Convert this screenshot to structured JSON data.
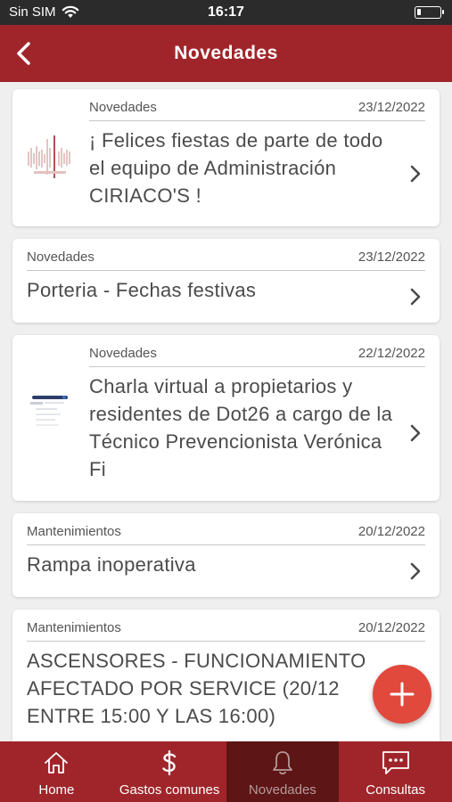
{
  "status_bar": {
    "carrier": "Sin SIM",
    "time": "16:17"
  },
  "header": {
    "title": "Novedades"
  },
  "items": [
    {
      "category": "Novedades",
      "date": "23/12/2022",
      "title": "¡ Felices fiestas de parte de todo el equipo de Administración CIRIACO'S !"
    },
    {
      "category": "Novedades",
      "date": "23/12/2022",
      "title": "Porteria - Fechas festivas"
    },
    {
      "category": "Novedades",
      "date": "22/12/2022",
      "title": "Charla virtual a propietarios y residentes de Dot26 a cargo de la Técnico Prevencionista Verónica Fi"
    },
    {
      "category": "Mantenimientos",
      "date": "20/12/2022",
      "title": "Rampa inoperativa"
    },
    {
      "category": "Mantenimientos",
      "date": "20/12/2022",
      "title": "ASCENSORES - FUNCIONAMIENTO AFECTADO POR SERVICE (20/12 ENTRE 15:00 Y LAS 16:00)"
    }
  ],
  "nav": [
    {
      "label": "Home",
      "icon": "home-icon"
    },
    {
      "label": "Gastos comunes",
      "icon": "dollar-icon"
    },
    {
      "label": "Novedades",
      "icon": "bell-icon"
    },
    {
      "label": "Consultas",
      "icon": "chat-icon"
    }
  ],
  "colors": {
    "brand": "#a0252a",
    "nav_active": "#5e1515",
    "fab": "#e0493c"
  }
}
